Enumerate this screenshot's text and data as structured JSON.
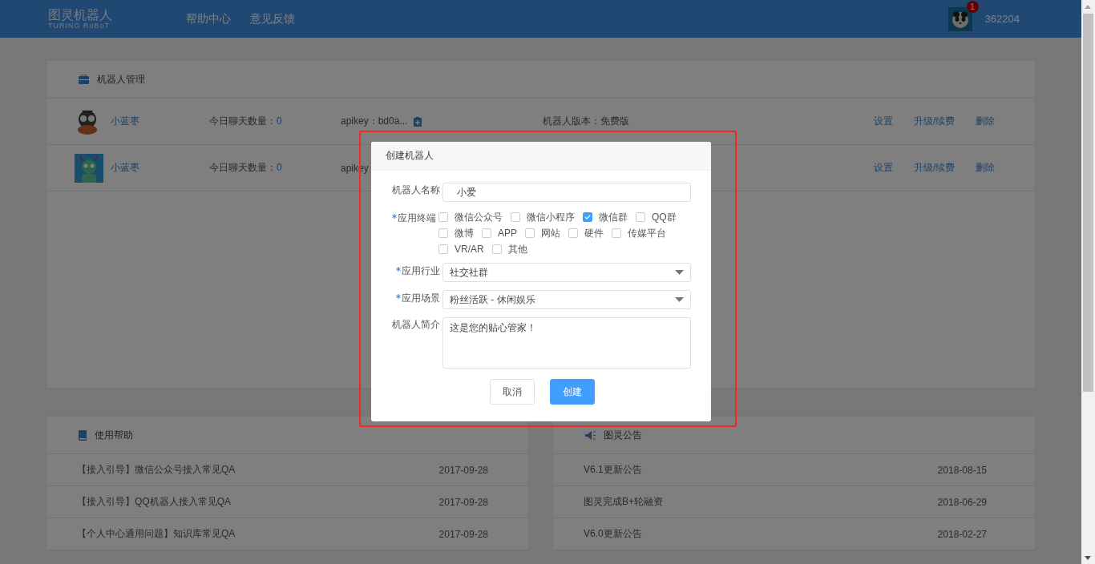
{
  "header": {
    "logo_title": "图灵机器人",
    "logo_subtitle": "TURING RoBoT",
    "nav": [
      {
        "label": "帮助中心"
      },
      {
        "label": "意见反馈"
      }
    ],
    "notification_count": "1",
    "user_id": "362204"
  },
  "robot_panel": {
    "title": "机器人管理",
    "robots": [
      {
        "kind": "creature",
        "name": "小蓝枣",
        "chat_label": "今日聊天数量：",
        "chat_count": "0",
        "apikey": "apikey：bd0a...",
        "version": "机器人版本：免费版",
        "actions": [
          "设置",
          "升级/续费",
          "删除"
        ]
      },
      {
        "kind": "robot",
        "name": "小蓝枣",
        "chat_label": "今日聊天数量：",
        "chat_count": "0",
        "apikey": "apikey",
        "actions": [
          "设置",
          "升级/续费",
          "删除"
        ]
      }
    ]
  },
  "help_panel": {
    "title": "使用帮助",
    "rows": [
      {
        "title": "【接入引导】微信公众号接入常见QA",
        "date": "2017-09-28"
      },
      {
        "title": "【接入引导】QQ机器人接入常见QA",
        "date": "2017-09-28"
      },
      {
        "title": "【个人中心通用问题】知识库常见QA",
        "date": "2017-09-28"
      }
    ]
  },
  "notice_panel": {
    "title": "图灵公告",
    "rows": [
      {
        "title": "V6.1更新公告",
        "date": "2018-08-15"
      },
      {
        "title": "图灵完成B+轮融资",
        "date": "2018-06-29"
      },
      {
        "title": "V6.0更新公告",
        "date": "2018-02-27"
      }
    ]
  },
  "dialog": {
    "title": "创建机器人",
    "fields": [
      {
        "kind": "text",
        "label": "机器人名称",
        "required": false,
        "value": "小爱"
      },
      {
        "kind": "checkboxes",
        "label": "应用终端",
        "required": true,
        "options": [
          {
            "label": "微信公众号",
            "checked": false
          },
          {
            "label": "微信小程序",
            "checked": false
          },
          {
            "label": "微信群",
            "checked": true
          },
          {
            "label": "QQ群",
            "checked": false
          },
          {
            "label": "微博",
            "checked": false
          },
          {
            "label": "APP",
            "checked": false
          },
          {
            "label": "网站",
            "checked": false
          },
          {
            "label": "硬件",
            "checked": false
          },
          {
            "label": "传媒平台",
            "checked": false
          },
          {
            "label": "VR/AR",
            "checked": false
          },
          {
            "label": "其他",
            "checked": false
          }
        ]
      },
      {
        "kind": "select",
        "label": "应用行业",
        "required": true,
        "value": "社交社群"
      },
      {
        "kind": "select",
        "label": "应用场景",
        "required": true,
        "value": "粉丝活跃 - 休闲娱乐"
      },
      {
        "kind": "textarea",
        "label": "机器人简介",
        "required": false,
        "value": "这是您的贴心管家！"
      }
    ],
    "buttons": [
      {
        "label": "取消",
        "primary": false
      },
      {
        "label": "创建",
        "primary": true
      }
    ]
  },
  "highlight": {
    "shown": true
  }
}
